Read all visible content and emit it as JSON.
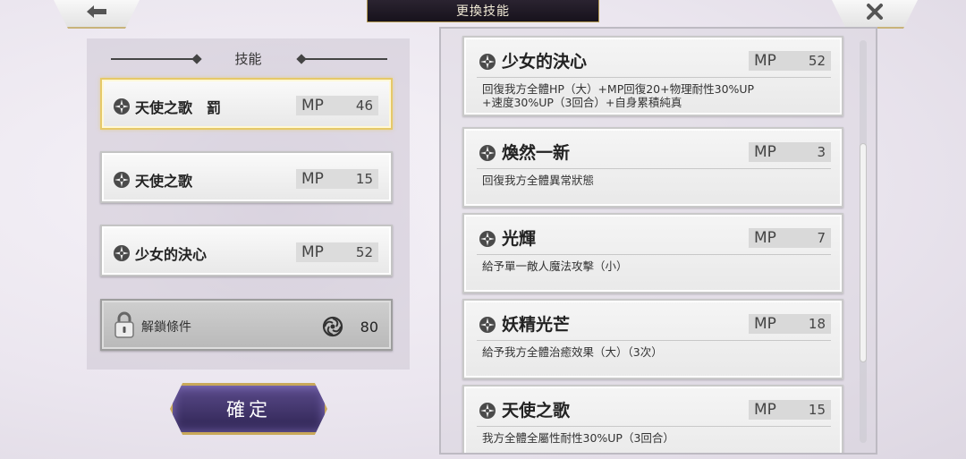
{
  "header": {
    "title": "更換技能",
    "back_icon": "arrow-left-icon",
    "close_icon": "close-icon"
  },
  "left_panel": {
    "heading": "技能",
    "slots": [
      {
        "name": "天使之歌　罰",
        "mp_label": "MP",
        "mp": "46",
        "selected": true
      },
      {
        "name": "天使之歌",
        "mp_label": "MP",
        "mp": "15",
        "selected": false
      },
      {
        "name": "少女的決心",
        "mp_label": "MP",
        "mp": "52",
        "selected": false
      }
    ],
    "locked_slot": {
      "label": "解鎖條件",
      "cost": "80",
      "icon": "lock-icon",
      "currency_icon": "spiral-icon"
    },
    "confirm_label": "確定"
  },
  "skill_list": [
    {
      "name": "少女的決心",
      "mp_label": "MP",
      "mp": "52",
      "desc1": "回復我方全體HP（大）+MP回復20+物理耐性30%UP",
      "desc2": "+速度30%UP（3回合）+自身累積純真"
    },
    {
      "name": "煥然一新",
      "mp_label": "MP",
      "mp": "3",
      "desc1": "回復我方全體異常狀態",
      "desc2": ""
    },
    {
      "name": "光輝",
      "mp_label": "MP",
      "mp": "7",
      "desc1": "給予單一敵人魔法攻擊（小）",
      "desc2": ""
    },
    {
      "name": "妖精光芒",
      "mp_label": "MP",
      "mp": "18",
      "desc1": "給予我方全體治癒效果（大）（3次）",
      "desc2": ""
    },
    {
      "name": "天使之歌",
      "mp_label": "MP",
      "mp": "15",
      "desc1": "我方全體全屬性耐性30%UP（3回合）",
      "desc2": ""
    }
  ],
  "colors": {
    "gold_border": "#e6c968",
    "confirm_bg": "#3d3168",
    "banner_bg": "#1f1925"
  }
}
